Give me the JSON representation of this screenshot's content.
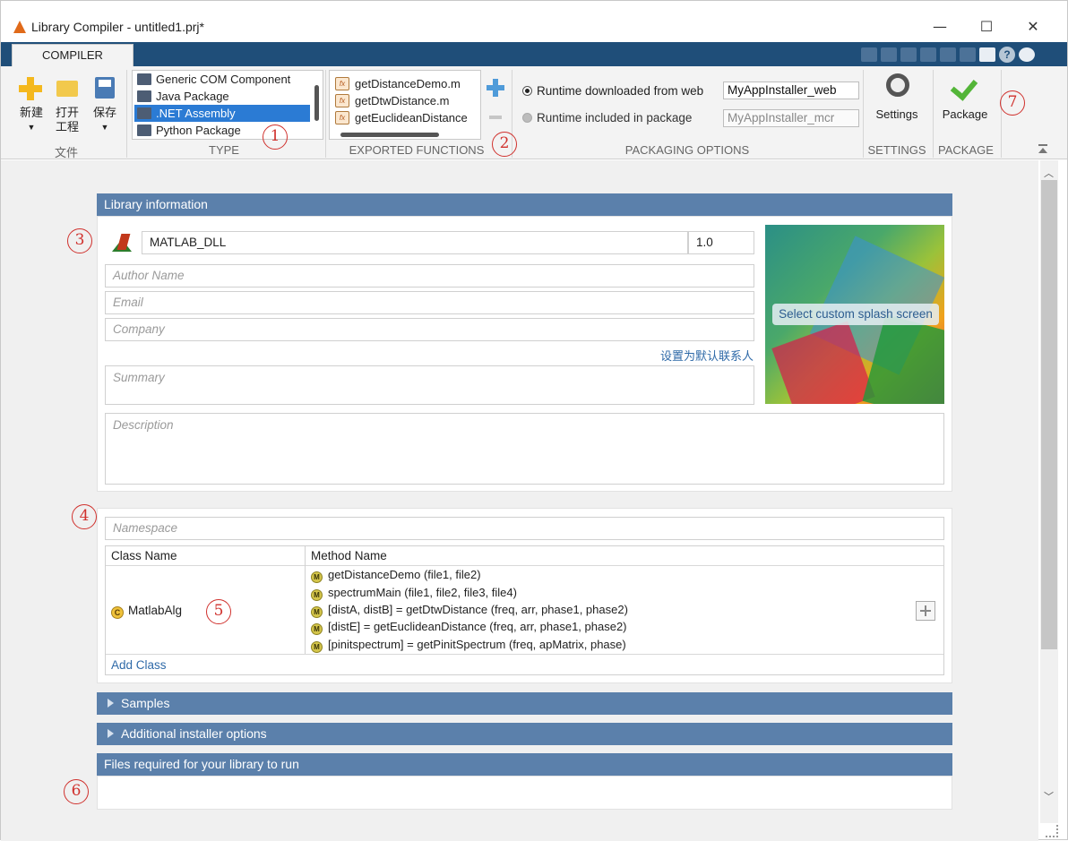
{
  "window": {
    "title": "Library Compiler - untitled1.prj*",
    "minimize_glyph": "—",
    "maximize_glyph": "☐",
    "close_glyph": "✕"
  },
  "tabs": {
    "compiler": "COMPILER"
  },
  "ribbon": {
    "file_group": {
      "label": "文件",
      "new_label": "新建",
      "open_label_1": "打开",
      "open_label_2": "工程",
      "save_label": "保存",
      "dropdown_glyph": "▼"
    },
    "type_group": {
      "label": "TYPE",
      "items": [
        "Generic COM Component",
        "Java Package",
        ".NET Assembly",
        "Python Package"
      ],
      "selected_index": 2
    },
    "exported_functions": {
      "label": "EXPORTED FUNCTIONS",
      "items": [
        "getDistanceDemo.m",
        "getDtwDistance.m",
        "getEuclideanDistance"
      ]
    },
    "packaging_options": {
      "label": "PACKAGING OPTIONS",
      "runtime_web_label": "Runtime downloaded from web",
      "runtime_web_value": "MyAppInstaller_web",
      "runtime_included_label": "Runtime included in package",
      "runtime_included_value": "MyAppInstaller_mcr"
    },
    "settings": {
      "label": "SETTINGS",
      "button": "Settings"
    },
    "package": {
      "label": "PACKAGE",
      "button": "Package"
    }
  },
  "annotations": [
    "1",
    "2",
    "3",
    "4",
    "5",
    "6",
    "7"
  ],
  "library_info": {
    "header": "Library information",
    "library_name": "MATLAB_DLL",
    "version": "1.0",
    "author_placeholder": "Author Name",
    "email_placeholder": "Email",
    "company_placeholder": "Company",
    "set_default_contact": "设置为默认联系人",
    "summary_placeholder": "Summary",
    "description_placeholder": "Description",
    "splash_button": "Select custom splash screen"
  },
  "class_section": {
    "namespace_placeholder": "Namespace",
    "col_class_name": "Class Name",
    "col_method_name": "Method Name",
    "class_name": "MatlabAlg",
    "class_icon": "C",
    "method_icon": "M",
    "methods": [
      "getDistanceDemo (file1, file2)",
      "spectrumMain (file1, file2, file3, file4)",
      "[distA, distB] = getDtwDistance (freq, arr, phase1, phase2)",
      "[distE] = getEuclideanDistance (freq, arr, phase1, phase2)",
      "[pinitspectrum] = getPinitSpectrum (freq, apMatrix, phase)"
    ],
    "add_class": "Add Class"
  },
  "sections": {
    "samples": "Samples",
    "installer_options": "Additional installer options",
    "files_required": "Files required for your library to run"
  },
  "colors": {
    "tab_strip": "#1f4e79",
    "section_header": "#5b80ab",
    "selected_item": "#2b7bd4",
    "annotation": "#d0312d"
  }
}
